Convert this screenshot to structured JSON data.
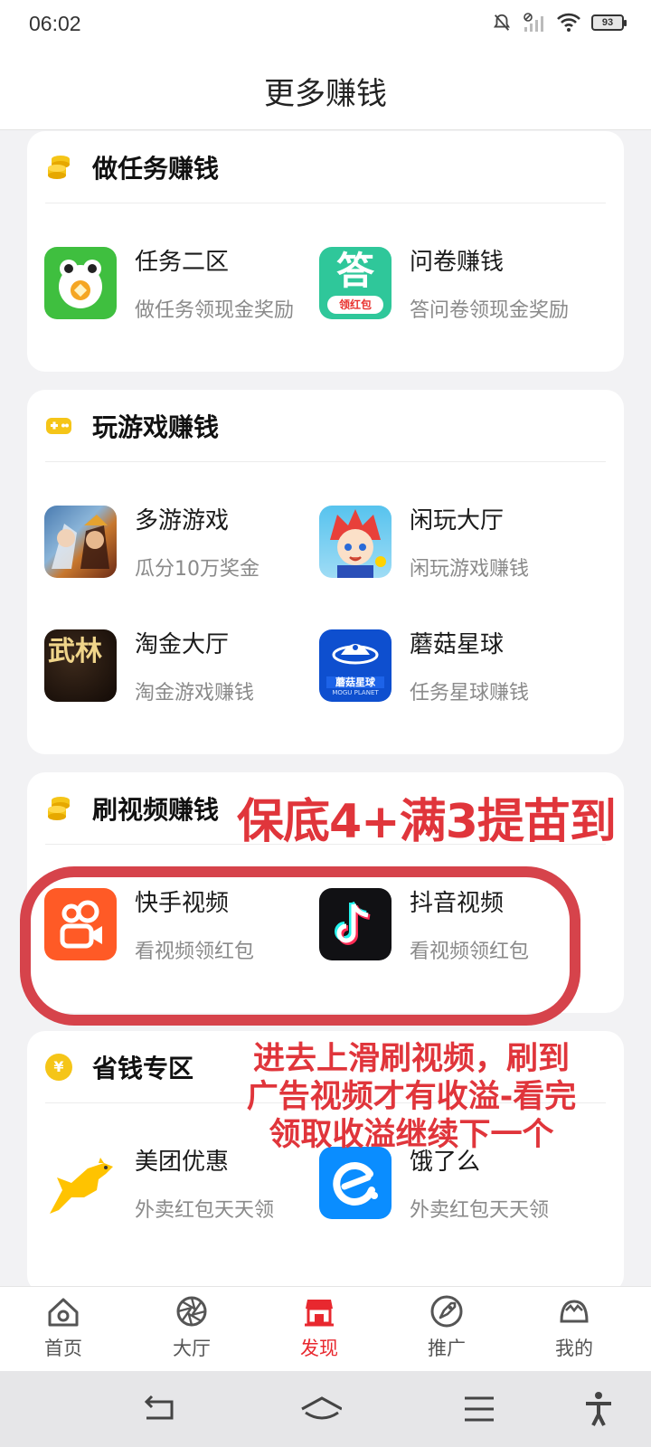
{
  "status": {
    "time": "06:02",
    "battery": "93"
  },
  "header": {
    "title": "更多赚钱"
  },
  "sections": [
    {
      "title": "做任务赚钱",
      "icon": "coins-icon",
      "apps": [
        {
          "name": "任务二区",
          "desc": "做任务领现金奖励",
          "icon": "frog-coin-icon"
        },
        {
          "name": "问卷赚钱",
          "desc": "答问卷领现金奖励",
          "icon": "answer-red-packet-icon",
          "icon_text": "答",
          "icon_sub": "领红包"
        }
      ]
    },
    {
      "title": "玩游戏赚钱",
      "icon": "gamepad-icon",
      "apps": [
        {
          "name": "多游游戏",
          "desc": "瓜分10万奖金",
          "icon": "game-heroes-icon"
        },
        {
          "name": "闲玩大厅",
          "desc": "闲玩游戏赚钱",
          "icon": "anime-boy-icon"
        },
        {
          "name": "淘金大厅",
          "desc": "淘金游戏赚钱",
          "icon": "wulin-icon",
          "icon_text": "武林"
        },
        {
          "name": "蘑菇星球",
          "desc": "任务星球赚钱",
          "icon": "mogu-planet-icon",
          "icon_text": "蘑菇星球",
          "icon_sub": "MOGU PLANET"
        }
      ]
    },
    {
      "title": "刷视频赚钱",
      "icon": "coins-icon",
      "apps": [
        {
          "name": "快手视频",
          "desc": "看视频领红包",
          "icon": "kuaishou-icon"
        },
        {
          "name": "抖音视频",
          "desc": "看视频领红包",
          "icon": "douyin-icon"
        }
      ]
    },
    {
      "title": "省钱专区",
      "icon": "yen-icon",
      "icon_text": "¥",
      "apps": [
        {
          "name": "美团优惠",
          "desc": "外卖红包天天领",
          "icon": "meituan-kangaroo-icon"
        },
        {
          "name": "饿了么",
          "desc": "外卖红包天天领",
          "icon": "eleme-icon"
        }
      ]
    }
  ],
  "annotations": {
    "top": "保底4+满3提苗到",
    "bottom_lines": [
      "进去上滑刷视频，刷到",
      "广告视频才有收溢-看完",
      "领取收溢继续下一个"
    ]
  },
  "tabs": [
    {
      "label": "首页",
      "icon": "home-icon",
      "active": false
    },
    {
      "label": "大厅",
      "icon": "aperture-icon",
      "active": false
    },
    {
      "label": "发现",
      "icon": "shop-icon",
      "active": true
    },
    {
      "label": "推广",
      "icon": "rocket-icon",
      "active": false
    },
    {
      "label": "我的",
      "icon": "profile-icon",
      "active": false
    }
  ],
  "colors": {
    "accent": "#e8282f",
    "annotation": "#e0353b",
    "coin": "#f5c518"
  }
}
